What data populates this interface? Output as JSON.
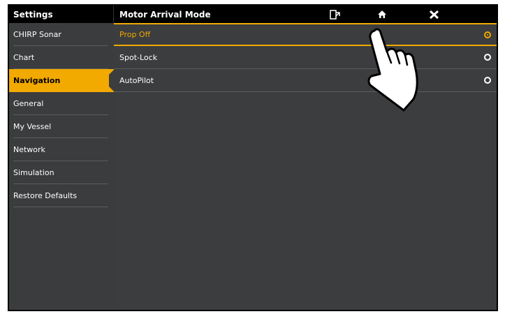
{
  "sidebar": {
    "title": "Settings",
    "items": [
      {
        "label": "CHIRP Sonar"
      },
      {
        "label": "Chart"
      },
      {
        "label": "Navigation"
      },
      {
        "label": "General"
      },
      {
        "label": "My Vessel"
      },
      {
        "label": "Network"
      },
      {
        "label": "Simulation"
      },
      {
        "label": "Restore Defaults"
      }
    ],
    "active_index": 2
  },
  "main": {
    "title": "Motor Arrival Mode",
    "icons": [
      "exit-menu-icon",
      "home-icon",
      "close-icon"
    ],
    "options": [
      {
        "label": "Prop Off",
        "selected": true
      },
      {
        "label": "Spot-Lock",
        "selected": false
      },
      {
        "label": "AutoPilot",
        "selected": false
      }
    ]
  },
  "colors": {
    "accent": "#f2a900",
    "title_bar": "#000000",
    "panel": "#3b3d3f",
    "text": "#ffffff"
  },
  "overlay": {
    "icon": "pointing-hand-icon"
  }
}
